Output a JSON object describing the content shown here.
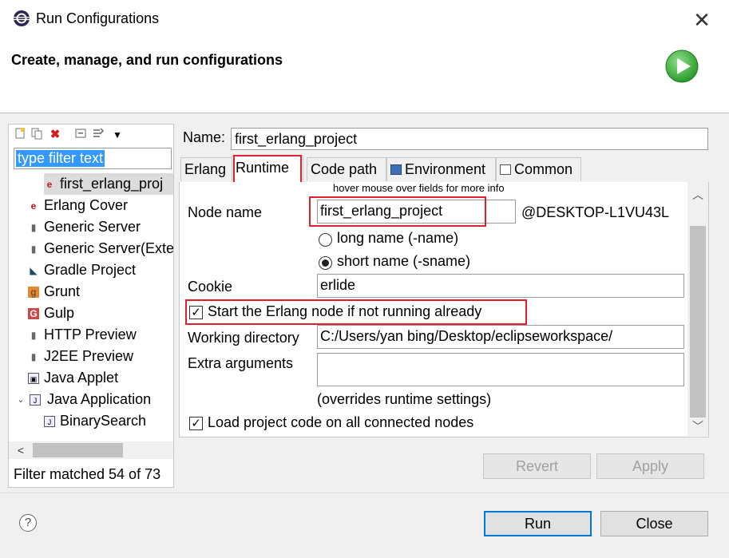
{
  "window": {
    "title": "Run Configurations"
  },
  "header": {
    "title": "Create, manage, and run configurations"
  },
  "left": {
    "filter_placeholder": "type filter text",
    "tree": [
      {
        "label": "first_erlang_proj",
        "icon": "erlang-icon",
        "indent": 2,
        "selected": true
      },
      {
        "label": "Erlang Cover",
        "icon": "erlang-icon",
        "indent": 1
      },
      {
        "label": "Generic Server",
        "icon": "server-icon",
        "indent": 1
      },
      {
        "label": "Generic Server(Exte",
        "icon": "server-icon",
        "indent": 1
      },
      {
        "label": "Gradle Project",
        "icon": "gradle-icon",
        "indent": 1
      },
      {
        "label": "Grunt",
        "icon": "grunt-icon",
        "indent": 1
      },
      {
        "label": "Gulp",
        "icon": "gulp-icon",
        "indent": 1
      },
      {
        "label": "HTTP Preview",
        "icon": "server-icon",
        "indent": 1
      },
      {
        "label": "J2EE Preview",
        "icon": "server-icon",
        "indent": 1
      },
      {
        "label": "Java Applet",
        "icon": "java-applet-icon",
        "indent": 1
      },
      {
        "label": "Java Application",
        "icon": "java-app-icon",
        "indent": 1,
        "expanded": true
      },
      {
        "label": "BinarySearch",
        "icon": "java-app-icon",
        "indent": 2
      }
    ],
    "filter_status": "Filter matched 54 of 73"
  },
  "config": {
    "name_label": "Name:",
    "name_value": "first_erlang_project",
    "tabs": [
      {
        "label": "Erlang",
        "icon": ""
      },
      {
        "label": "Runtime",
        "icon": "",
        "active": true
      },
      {
        "label": "Code path",
        "icon": ""
      },
      {
        "label": "Environment",
        "icon": "environment-icon"
      },
      {
        "label": "Common",
        "icon": "common-icon"
      }
    ],
    "hover_hint": "hover mouse over fields for more info",
    "node_name_label": "Node name",
    "node_name_value": "first_erlang_project",
    "node_host": "@DESKTOP-L1VU43L",
    "long_name_label": "long name (-name)",
    "short_name_label": "short name (-sname)",
    "selected_name_mode": "short",
    "cookie_label": "Cookie",
    "cookie_value": "erlide",
    "start_node_label": "Start the Erlang node if not running already",
    "start_node_checked": true,
    "working_dir_label": "Working directory",
    "working_dir_value": "C:/Users/yan bing/Desktop/eclipseworkspace/",
    "extra_args_label": "Extra arguments",
    "extra_args_value": "",
    "overrides_note": "(overrides runtime settings)",
    "load_code_label": "Load project code on all connected nodes",
    "load_code_checked": true
  },
  "buttons": {
    "revert": "Revert",
    "apply": "Apply",
    "run": "Run",
    "close": "Close"
  },
  "colors": {
    "highlight": "#e0202a",
    "selection": "#3399ff",
    "run_green": "#3cb043"
  }
}
